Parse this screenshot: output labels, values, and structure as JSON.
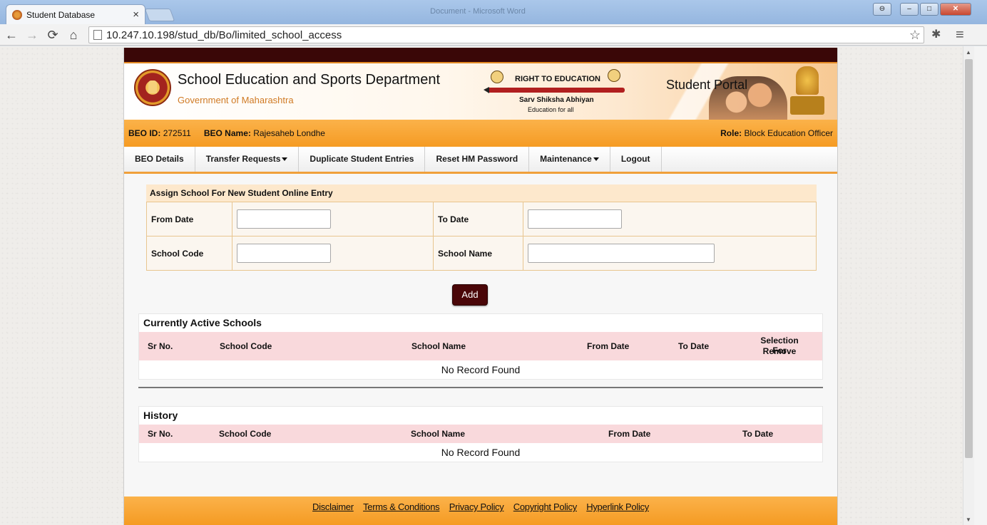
{
  "browser": {
    "tab_title": "Student Database",
    "tab_close": "×",
    "window_title": "Document - Microsoft Word",
    "url": "10.247.10.198/stud_db/Bo/limited_school_access",
    "back": "←",
    "forward": "→",
    "reload": "⟳",
    "home": "⌂",
    "star": "☆",
    "extensions": "✱",
    "menu": "≡",
    "win_user": "⊖",
    "win_min": "–",
    "win_max": "□",
    "win_close": "✕"
  },
  "header": {
    "dept_title": "School Education and Sports Department",
    "dept_subtitle": "Government of Maharashtra",
    "rte_title": "RIGHT TO EDUCATION",
    "rte_subtitle": "Sarv Shiksha Abhiyan",
    "rte_tagline": "Education for all",
    "portal_title": "Student Portal"
  },
  "info": {
    "beo_id_label": "BEO ID:",
    "beo_id": "272511",
    "beo_name_label": "BEO Name:",
    "beo_name": "Rajesaheb Londhe",
    "role_label": "Role:",
    "role": "Block Education Officer"
  },
  "menu": {
    "items": [
      {
        "label": "BEO Details"
      },
      {
        "label": "Transfer Requests"
      },
      {
        "label": "Duplicate Student Entries"
      },
      {
        "label": "Reset HM Password"
      },
      {
        "label": "Maintenance"
      },
      {
        "label": "Logout"
      }
    ]
  },
  "form": {
    "heading": "Assign School For New Student Online Entry",
    "from_date_label": "From Date",
    "from_date_value": "",
    "to_date_label": "To Date",
    "to_date_value": "",
    "school_code_label": "School Code",
    "school_code_value": "",
    "school_name_label": "School Name",
    "school_name_value": "",
    "add_label": "Add"
  },
  "active": {
    "title": "Currently Active Schools",
    "columns": [
      "Sr No.",
      "School Code",
      "School Name",
      "From Date",
      "To Date",
      "Selection For",
      "Remove"
    ],
    "empty": "No Record Found"
  },
  "history": {
    "title": "History",
    "columns": [
      "Sr No.",
      "School Code",
      "School Name",
      "From Date",
      "To Date"
    ],
    "empty": "No Record Found"
  },
  "footer": {
    "links": [
      "Disclaimer",
      "Terms & Conditions",
      "Privacy Policy",
      "Copyright Policy",
      "Hyperlink Policy"
    ]
  }
}
